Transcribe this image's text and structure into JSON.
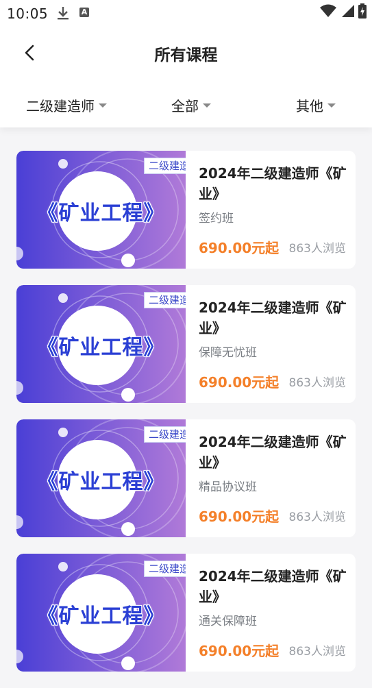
{
  "status_bar": {
    "time": "10:05",
    "icons": [
      "download-icon",
      "a-badge-icon",
      "wifi-icon",
      "signal-icon",
      "battery-icon"
    ],
    "a_badge": "A"
  },
  "header": {
    "title": "所有课程",
    "back_icon": "chevron-left-icon"
  },
  "filters": [
    {
      "label": "二级建造师"
    },
    {
      "label": "全部"
    },
    {
      "label": "其他"
    }
  ],
  "colors": {
    "accent_price": "#f4802a",
    "thumb_gradient_start": "#4a3fd6",
    "thumb_gradient_end": "#b07ad8"
  },
  "courses": [
    {
      "thumb_title": "《矿业工程》",
      "thumb_tag": "二级建造",
      "title": "2024年二级建造师《矿业》",
      "subtitle": "签约班",
      "price": "690.00元起",
      "views": "863人浏览"
    },
    {
      "thumb_title": "《矿业工程》",
      "thumb_tag": "二级建造",
      "title": "2024年二级建造师《矿业》",
      "subtitle": "保障无忧班",
      "price": "690.00元起",
      "views": "863人浏览"
    },
    {
      "thumb_title": "《矿业工程》",
      "thumb_tag": "二级建造",
      "title": "2024年二级建造师《矿业》",
      "subtitle": "精品协议班",
      "price": "690.00元起",
      "views": "863人浏览"
    },
    {
      "thumb_title": "《矿业工程》",
      "thumb_tag": "二级建造",
      "title": "2024年二级建造师《矿业》",
      "subtitle": "通关保障班",
      "price": "690.00元起",
      "views": "863人浏览"
    }
  ]
}
